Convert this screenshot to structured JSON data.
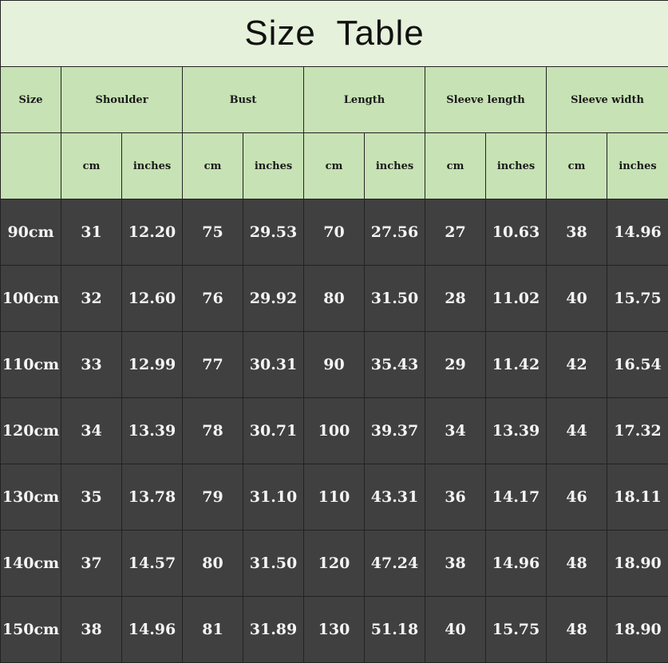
{
  "title": "Size  Table",
  "columns": {
    "size": "Size",
    "groups": [
      "Shoulder",
      "Bust",
      "Length",
      "Sleeve length",
      "Sleeve width"
    ],
    "cm": "cm",
    "inches": "inches"
  },
  "rows": [
    {
      "size": "90cm",
      "shoulder_cm": "31",
      "shoulder_in": "12.20",
      "bust_cm": "75",
      "bust_in": "29.53",
      "length_cm": "70",
      "length_in": "27.56",
      "sleeve_length_cm": "27",
      "sleeve_length_in": "10.63",
      "sleeve_width_cm": "38",
      "sleeve_width_in": "14.96"
    },
    {
      "size": "100cm",
      "shoulder_cm": "32",
      "shoulder_in": "12.60",
      "bust_cm": "76",
      "bust_in": "29.92",
      "length_cm": "80",
      "length_in": "31.50",
      "sleeve_length_cm": "28",
      "sleeve_length_in": "11.02",
      "sleeve_width_cm": "40",
      "sleeve_width_in": "15.75"
    },
    {
      "size": "110cm",
      "shoulder_cm": "33",
      "shoulder_in": "12.99",
      "bust_cm": "77",
      "bust_in": "30.31",
      "length_cm": "90",
      "length_in": "35.43",
      "sleeve_length_cm": "29",
      "sleeve_length_in": "11.42",
      "sleeve_width_cm": "42",
      "sleeve_width_in": "16.54"
    },
    {
      "size": "120cm",
      "shoulder_cm": "34",
      "shoulder_in": "13.39",
      "bust_cm": "78",
      "bust_in": "30.71",
      "length_cm": "100",
      "length_in": "39.37",
      "sleeve_length_cm": "34",
      "sleeve_length_in": "13.39",
      "sleeve_width_cm": "44",
      "sleeve_width_in": "17.32"
    },
    {
      "size": "130cm",
      "shoulder_cm": "35",
      "shoulder_in": "13.78",
      "bust_cm": "79",
      "bust_in": "31.10",
      "length_cm": "110",
      "length_in": "43.31",
      "sleeve_length_cm": "36",
      "sleeve_length_in": "14.17",
      "sleeve_width_cm": "46",
      "sleeve_width_in": "18.11"
    },
    {
      "size": "140cm",
      "shoulder_cm": "37",
      "shoulder_in": "14.57",
      "bust_cm": "80",
      "bust_in": "31.50",
      "length_cm": "120",
      "length_in": "47.24",
      "sleeve_length_cm": "38",
      "sleeve_length_in": "14.96",
      "sleeve_width_cm": "48",
      "sleeve_width_in": "18.90"
    },
    {
      "size": "150cm",
      "shoulder_cm": "38",
      "shoulder_in": "14.96",
      "bust_cm": "81",
      "bust_in": "31.89",
      "length_cm": "130",
      "length_in": "51.18",
      "sleeve_length_cm": "40",
      "sleeve_length_in": "15.75",
      "sleeve_width_cm": "48",
      "sleeve_width_in": "18.90"
    }
  ],
  "colors": {
    "title_background": "#e6f1db",
    "header_background": "#c7e2b4",
    "data_background": "#404040",
    "data_text": "#f4f4f4",
    "border": "#222222"
  }
}
